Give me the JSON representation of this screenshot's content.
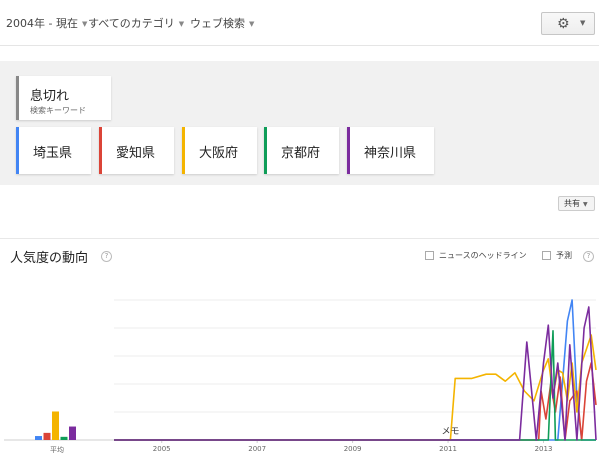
{
  "filters": {
    "date": "2004年 - 現在",
    "category": "すべてのカテゴリ",
    "source": "ウェブ検索"
  },
  "icons": {
    "settings": "gear-icon",
    "dropdown": "chevron-down-icon",
    "help": "question-circle-icon"
  },
  "main_keyword": {
    "text": "息切れ",
    "sub": "検索キーワード",
    "color": "#888888"
  },
  "regions": [
    {
      "label": "埼玉県",
      "color": "#4285f4"
    },
    {
      "label": "愛知県",
      "color": "#db4437"
    },
    {
      "label": "大阪府",
      "color": "#f4b400"
    },
    {
      "label": "京都府",
      "color": "#0f9d58"
    },
    {
      "label": "神奈川県",
      "color": "#7b2c9e"
    }
  ],
  "share_label": "共有",
  "section": {
    "title": "人気度の動向",
    "news_headlines_label": "ニュースのヘッドライン",
    "forecast_label": "予測"
  },
  "chart_data": {
    "type": "line",
    "x_tick_labels": [
      "2005",
      "2007",
      "2009",
      "2011",
      "2013"
    ],
    "x_range": [
      2004,
      2014.1
    ],
    "y_range": [
      0,
      100
    ],
    "grid": true,
    "annotation": "メモ",
    "average_label": "平均",
    "averages": [
      {
        "name": "埼玉県",
        "value": 5
      },
      {
        "name": "愛知県",
        "value": 9
      },
      {
        "name": "大阪府",
        "value": 36
      },
      {
        "name": "京都府",
        "value": 4
      },
      {
        "name": "神奈川県",
        "value": 17
      }
    ],
    "series": [
      {
        "name": "埼玉県",
        "points": [
          [
            2004,
            0
          ],
          [
            2013.3,
            0
          ],
          [
            2013.4,
            42
          ],
          [
            2013.5,
            85
          ],
          [
            2013.6,
            100
          ],
          [
            2013.7,
            30
          ],
          [
            2013.8,
            0
          ],
          [
            2014.1,
            0
          ]
        ]
      },
      {
        "name": "愛知県",
        "points": [
          [
            2004,
            0
          ],
          [
            2012.9,
            0
          ],
          [
            2012.95,
            35
          ],
          [
            2013.05,
            15
          ],
          [
            2013.15,
            40
          ],
          [
            2013.25,
            20
          ],
          [
            2013.35,
            45
          ],
          [
            2013.45,
            0
          ],
          [
            2013.55,
            28
          ],
          [
            2013.7,
            35
          ],
          [
            2013.8,
            0
          ],
          [
            2013.9,
            42
          ],
          [
            2014,
            55
          ],
          [
            2014.1,
            25
          ]
        ]
      },
      {
        "name": "大阪府",
        "points": [
          [
            2004,
            0
          ],
          [
            2011.05,
            0
          ],
          [
            2011.15,
            44
          ],
          [
            2011.5,
            44
          ],
          [
            2011.8,
            47
          ],
          [
            2012.0,
            47
          ],
          [
            2012.2,
            42
          ],
          [
            2012.4,
            48
          ],
          [
            2012.6,
            35
          ],
          [
            2012.8,
            28
          ],
          [
            2013.0,
            50
          ],
          [
            2013.1,
            58
          ],
          [
            2013.2,
            32
          ],
          [
            2013.3,
            50
          ],
          [
            2013.4,
            48
          ],
          [
            2013.5,
            28
          ],
          [
            2013.6,
            55
          ],
          [
            2013.7,
            20
          ],
          [
            2013.8,
            55
          ],
          [
            2013.9,
            65
          ],
          [
            2014.0,
            75
          ],
          [
            2014.1,
            50
          ]
        ]
      },
      {
        "name": "京都府",
        "points": [
          [
            2004,
            0
          ],
          [
            2013.1,
            0
          ],
          [
            2013.15,
            40
          ],
          [
            2013.2,
            78
          ],
          [
            2013.25,
            0
          ],
          [
            2014.1,
            0
          ]
        ]
      },
      {
        "name": "神奈川県",
        "points": [
          [
            2004,
            0
          ],
          [
            2012.5,
            0
          ],
          [
            2012.65,
            70
          ],
          [
            2012.75,
            35
          ],
          [
            2012.85,
            0
          ],
          [
            2013.0,
            55
          ],
          [
            2013.1,
            82
          ],
          [
            2013.2,
            30
          ],
          [
            2013.3,
            55
          ],
          [
            2013.45,
            0
          ],
          [
            2013.55,
            68
          ],
          [
            2013.7,
            0
          ],
          [
            2013.85,
            80
          ],
          [
            2013.95,
            95
          ],
          [
            2014.1,
            0
          ]
        ]
      }
    ]
  }
}
